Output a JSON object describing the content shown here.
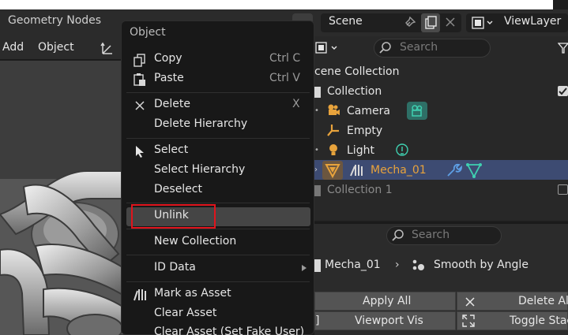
{
  "header": {
    "editor_title": "Geometry Nodes",
    "menus": [
      "Add",
      "Object"
    ]
  },
  "outliner_header": {
    "scene": "Scene",
    "view_layer": "ViewLayer"
  },
  "outliner": {
    "search_placeholder": "Search",
    "scene_collection": "cene Collection",
    "items": [
      {
        "label": "Collection"
      },
      {
        "label": "Camera"
      },
      {
        "label": "Empty"
      },
      {
        "label": "Light"
      },
      {
        "label": "Mecha_01"
      },
      {
        "label": "Collection 1"
      }
    ]
  },
  "properties": {
    "search_placeholder": "Search",
    "breadcrumb_object": "Mecha_01",
    "breadcrumb_modifier": "Smooth by Angle",
    "buttons": {
      "apply_all": "Apply All",
      "delete_all": "Delete All",
      "viewport_vis": "Viewport Vis",
      "toggle_stack": "Toggle Stac"
    }
  },
  "context_menu": {
    "title": "Object",
    "items": {
      "copy": "Copy",
      "copy_sc": "Ctrl C",
      "paste": "Paste",
      "paste_sc": "Ctrl V",
      "delete": "Delete",
      "delete_sc": "X",
      "delete_hierarchy": "Delete Hierarchy",
      "select": "Select",
      "select_hierarchy": "Select Hierarchy",
      "deselect": "Deselect",
      "unlink": "Unlink",
      "new_collection": "New Collection",
      "id_data": "ID Data",
      "mark_as_asset": "Mark as Asset",
      "clear_asset": "Clear Asset",
      "clear_asset_fake": "Clear Asset (Set Fake User)"
    }
  },
  "colors": {
    "highlight_box": "#e0141c",
    "selected_row": "#3d4b72",
    "object_orange": "#e8a33c",
    "modifier_blue": "#5ea0e6",
    "mesh_teal": "#3fd0b0"
  }
}
